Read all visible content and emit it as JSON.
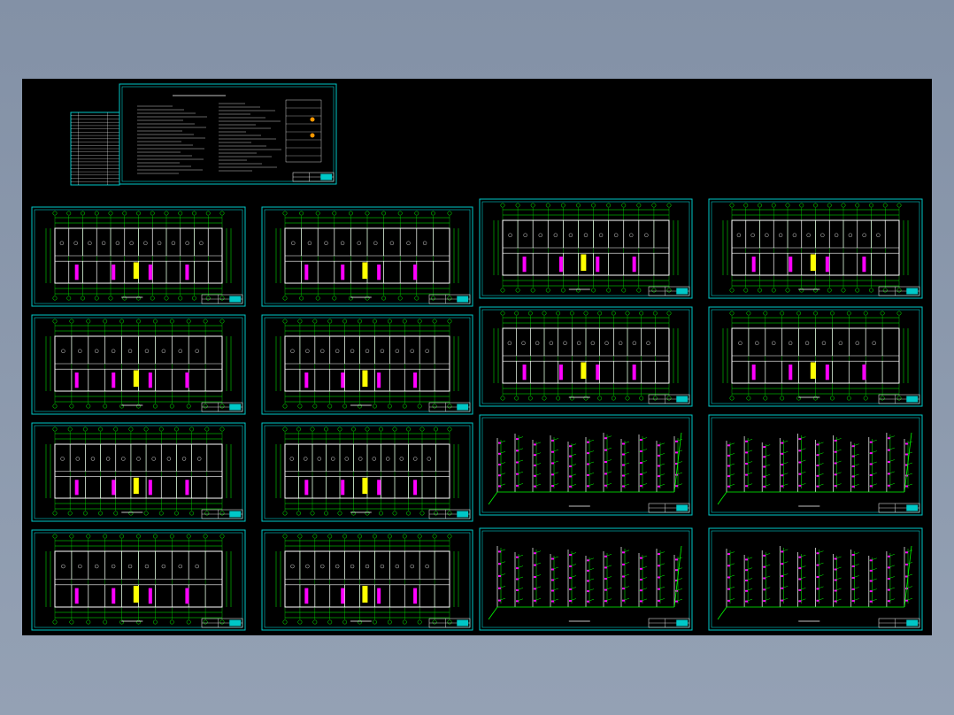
{
  "colors": {
    "background": "#8c99ad",
    "canvas": "#000000",
    "frame": "#00c8c8",
    "plan_lines": "#00ff00",
    "walls": "#ffffff",
    "fixtures": "#ff00ff",
    "highlight": "#ffff00",
    "text": "#ffffff"
  },
  "sheets": [
    {
      "kind": "index"
    },
    {
      "kind": "notes"
    },
    {
      "kind": "plan"
    },
    {
      "kind": "plan"
    },
    {
      "kind": "plan"
    },
    {
      "kind": "plan"
    },
    {
      "kind": "plan"
    },
    {
      "kind": "plan"
    },
    {
      "kind": "plan"
    },
    {
      "kind": "plan"
    },
    {
      "kind": "plan"
    },
    {
      "kind": "plan"
    },
    {
      "kind": "plan"
    },
    {
      "kind": "plan"
    },
    {
      "kind": "isometric"
    },
    {
      "kind": "isometric"
    },
    {
      "kind": "isometric"
    },
    {
      "kind": "isometric"
    }
  ]
}
